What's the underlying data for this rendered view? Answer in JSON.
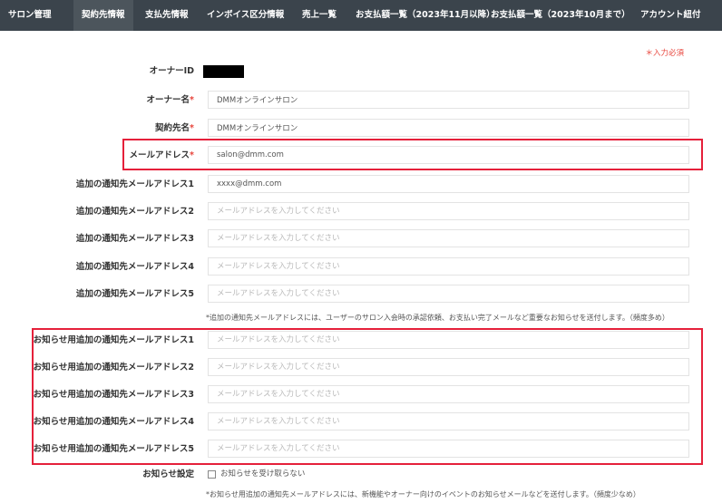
{
  "nav": {
    "tabs": [
      {
        "label": "サロン管理"
      },
      {
        "label": "契約先情報"
      },
      {
        "label": "支払先情報"
      },
      {
        "label": "インボイス区分情報"
      },
      {
        "label": "売上一覧"
      },
      {
        "label": "お支払額一覧（2023年11月以降）"
      },
      {
        "label": "お支払額一覧（2023年10月まで）"
      },
      {
        "label": "アカウント紐付"
      }
    ],
    "active_tab": "契約先情報"
  },
  "form": {
    "required_note": "＊入力必須",
    "owner_id_label": "オーナーID",
    "owner_name_label": "オーナー名",
    "owner_name_value": "DMMオンラインサロン",
    "contract_name_label": "契約先名",
    "contract_name_value": "DMMオンラインサロン",
    "email_label": "メールアドレス",
    "email_value": "salon@dmm.com",
    "required_mark": "*",
    "extra_emails": [
      {
        "label": "追加の通知先メールアドレス1",
        "value": "xxxx@dmm.com",
        "placeholder": "メールアドレスを入力してください"
      },
      {
        "label": "追加の通知先メールアドレス2",
        "value": "",
        "placeholder": "メールアドレスを入力してください"
      },
      {
        "label": "追加の通知先メールアドレス3",
        "value": "",
        "placeholder": "メールアドレスを入力してください"
      },
      {
        "label": "追加の通知先メールアドレス4",
        "value": "",
        "placeholder": "メールアドレスを入力してください"
      },
      {
        "label": "追加の通知先メールアドレス5",
        "value": "",
        "placeholder": "メールアドレスを入力してください"
      }
    ],
    "extra_note": "*追加の通知先メールアドレスには、ユーザーのサロン入会時の承認依頼、お支払い完了メールなど重要なお知らせを送付します。（頻度多め）",
    "news_emails": [
      {
        "label": "お知らせ用追加の通知先メールアドレス1",
        "value": "",
        "placeholder": "メールアドレスを入力してください"
      },
      {
        "label": "お知らせ用追加の通知先メールアドレス2",
        "value": "",
        "placeholder": "メールアドレスを入力してください"
      },
      {
        "label": "お知らせ用追加の通知先メールアドレス3",
        "value": "",
        "placeholder": "メールアドレスを入力してください"
      },
      {
        "label": "お知らせ用追加の通知先メールアドレス4",
        "value": "",
        "placeholder": "メールアドレスを入力してください"
      },
      {
        "label": "お知らせ用追加の通知先メールアドレス5",
        "value": "",
        "placeholder": "メールアドレスを入力してください"
      }
    ],
    "notice_setting_label": "お知らせ設定",
    "notice_checkbox_label": "お知らせを受け取らない",
    "notice_checked": false,
    "news_note": "*お知らせ用追加の通知先メールアドレスには、新機能やオーナー向けのイベントのお知らせメールなどを送付します。（頻度少なめ）"
  },
  "colors": {
    "nav_bg": "#3b444c",
    "nav_active_bg": "#4c555c",
    "highlight": "#e5203a",
    "required": "#e8453c"
  }
}
